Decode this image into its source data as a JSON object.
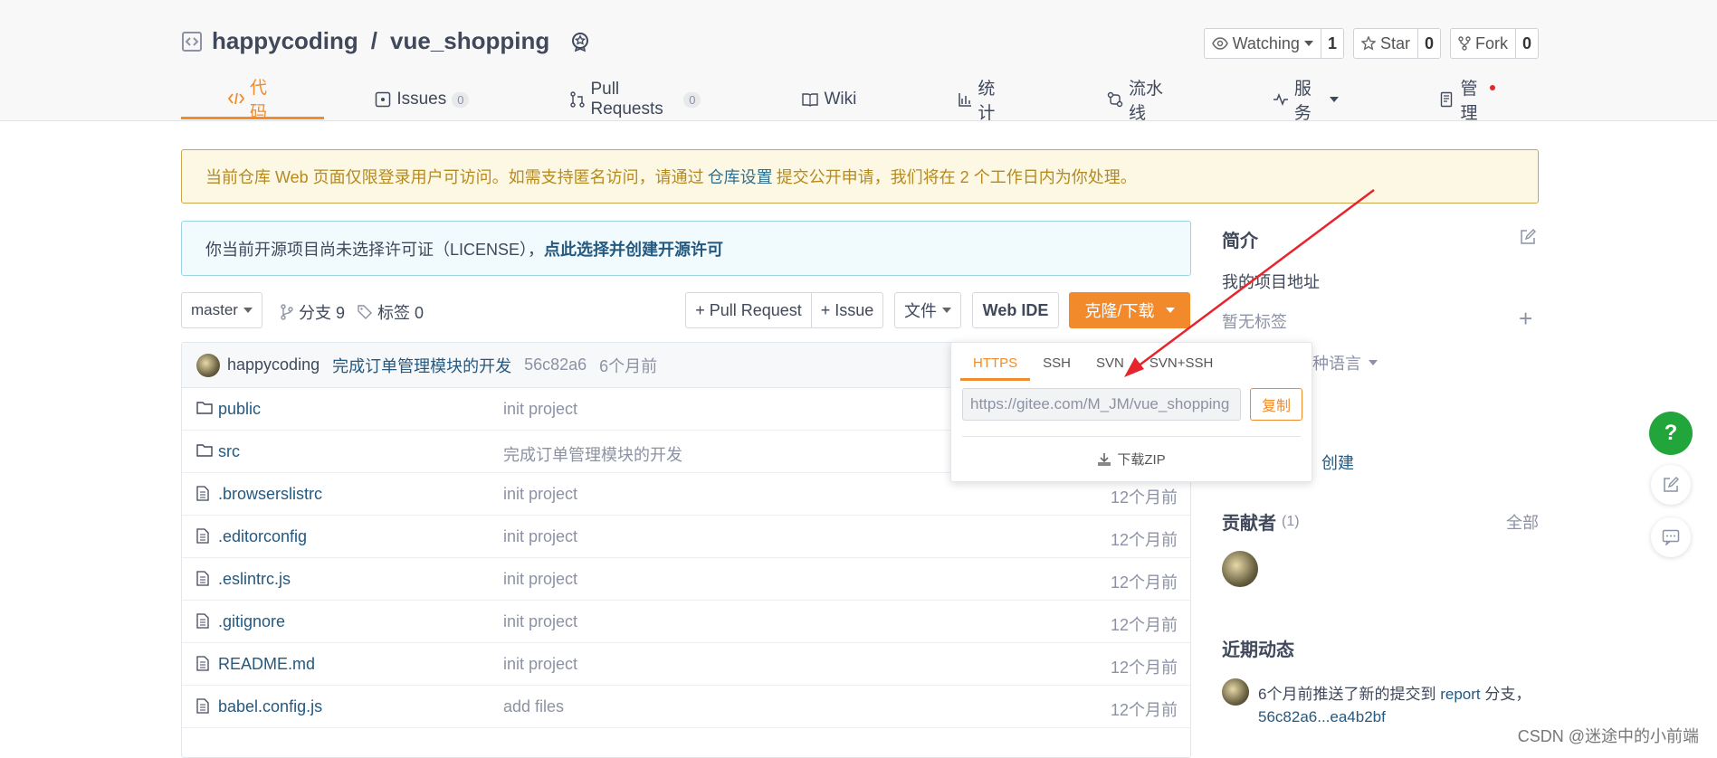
{
  "repo": {
    "owner": "happycoding",
    "separator": "/",
    "name": "vue_shopping"
  },
  "header_buttons": [
    {
      "label": "Watching",
      "count": "1"
    },
    {
      "label": "Star",
      "count": "0"
    },
    {
      "label": "Fork",
      "count": "0"
    }
  ],
  "tabs": [
    {
      "label": "代码",
      "badge": ""
    },
    {
      "label": "Issues",
      "badge": "0"
    },
    {
      "label": "Pull Requests",
      "badge": "0"
    },
    {
      "label": "Wiki",
      "badge": ""
    },
    {
      "label": "统计",
      "badge": ""
    },
    {
      "label": "流水线",
      "badge": ""
    },
    {
      "label": "服务",
      "badge": ""
    },
    {
      "label": "管理",
      "badge": ""
    }
  ],
  "notice": {
    "before": "当前仓库 Web 页面仅限登录用户可访问。如需支持匿名访问，请通过",
    "link": "仓库设置",
    "after": "提交公开申请，我们将在 2 个工作日内为你处理。"
  },
  "license": {
    "text": "你当前开源项目尚未选择许可证（LICENSE），",
    "link": "点此选择并创建开源许可"
  },
  "toolbar": {
    "branch": "master",
    "branches": "分支 9",
    "tags": "标签 0",
    "pull_request": "+ Pull Request",
    "issue": "+ Issue",
    "file": "文件",
    "web_ide": "Web IDE",
    "clone": "克隆/下载"
  },
  "last_commit": {
    "author": "happycoding",
    "message": "完成订单管理模块的开发",
    "hash": "56c82a6",
    "time": "6个月前"
  },
  "files": [
    {
      "type": "folder",
      "name": "public",
      "message": "init project",
      "time": ""
    },
    {
      "type": "folder",
      "name": "src",
      "message": "完成订单管理模块的开发",
      "time": ""
    },
    {
      "type": "file",
      "name": ".browserslistrc",
      "message": "init project",
      "time": "12个月前"
    },
    {
      "type": "file",
      "name": ".editorconfig",
      "message": "init project",
      "time": "12个月前"
    },
    {
      "type": "file",
      "name": ".eslintrc.js",
      "message": "init project",
      "time": "12个月前"
    },
    {
      "type": "file",
      "name": ".gitignore",
      "message": "init project",
      "time": "12个月前"
    },
    {
      "type": "file",
      "name": "README.md",
      "message": "init project",
      "time": "12个月前"
    },
    {
      "type": "file",
      "name": "babel.config.js",
      "message": "add files",
      "time": "12个月前"
    }
  ],
  "clone_dropdown": {
    "tabs": [
      "HTTPS",
      "SSH",
      "SVN",
      "SVN+SSH"
    ],
    "url": "https://gitee.com/M_JM/vue_shopping",
    "copy": "复制",
    "download": "下载ZIP"
  },
  "sidebar": {
    "intro_title": "简介",
    "description": "我的项目地址",
    "no_tags": "暂无标签",
    "languages": "种语言",
    "create": "创建",
    "contributors_title": "贡献者",
    "contributors_count": "(1)",
    "all": "全部",
    "activity_title": "近期动态",
    "activity_text": "6个月前推送了新的提交到",
    "activity_branch": "report",
    "activity_suffix": "分支，",
    "activity_range": "56c82a6...ea4b2bf"
  },
  "watermark": "CSDN @迷途中的小前端",
  "colors": {
    "accent": "#f08c2c",
    "link": "#245980",
    "help": "#22a53a"
  }
}
